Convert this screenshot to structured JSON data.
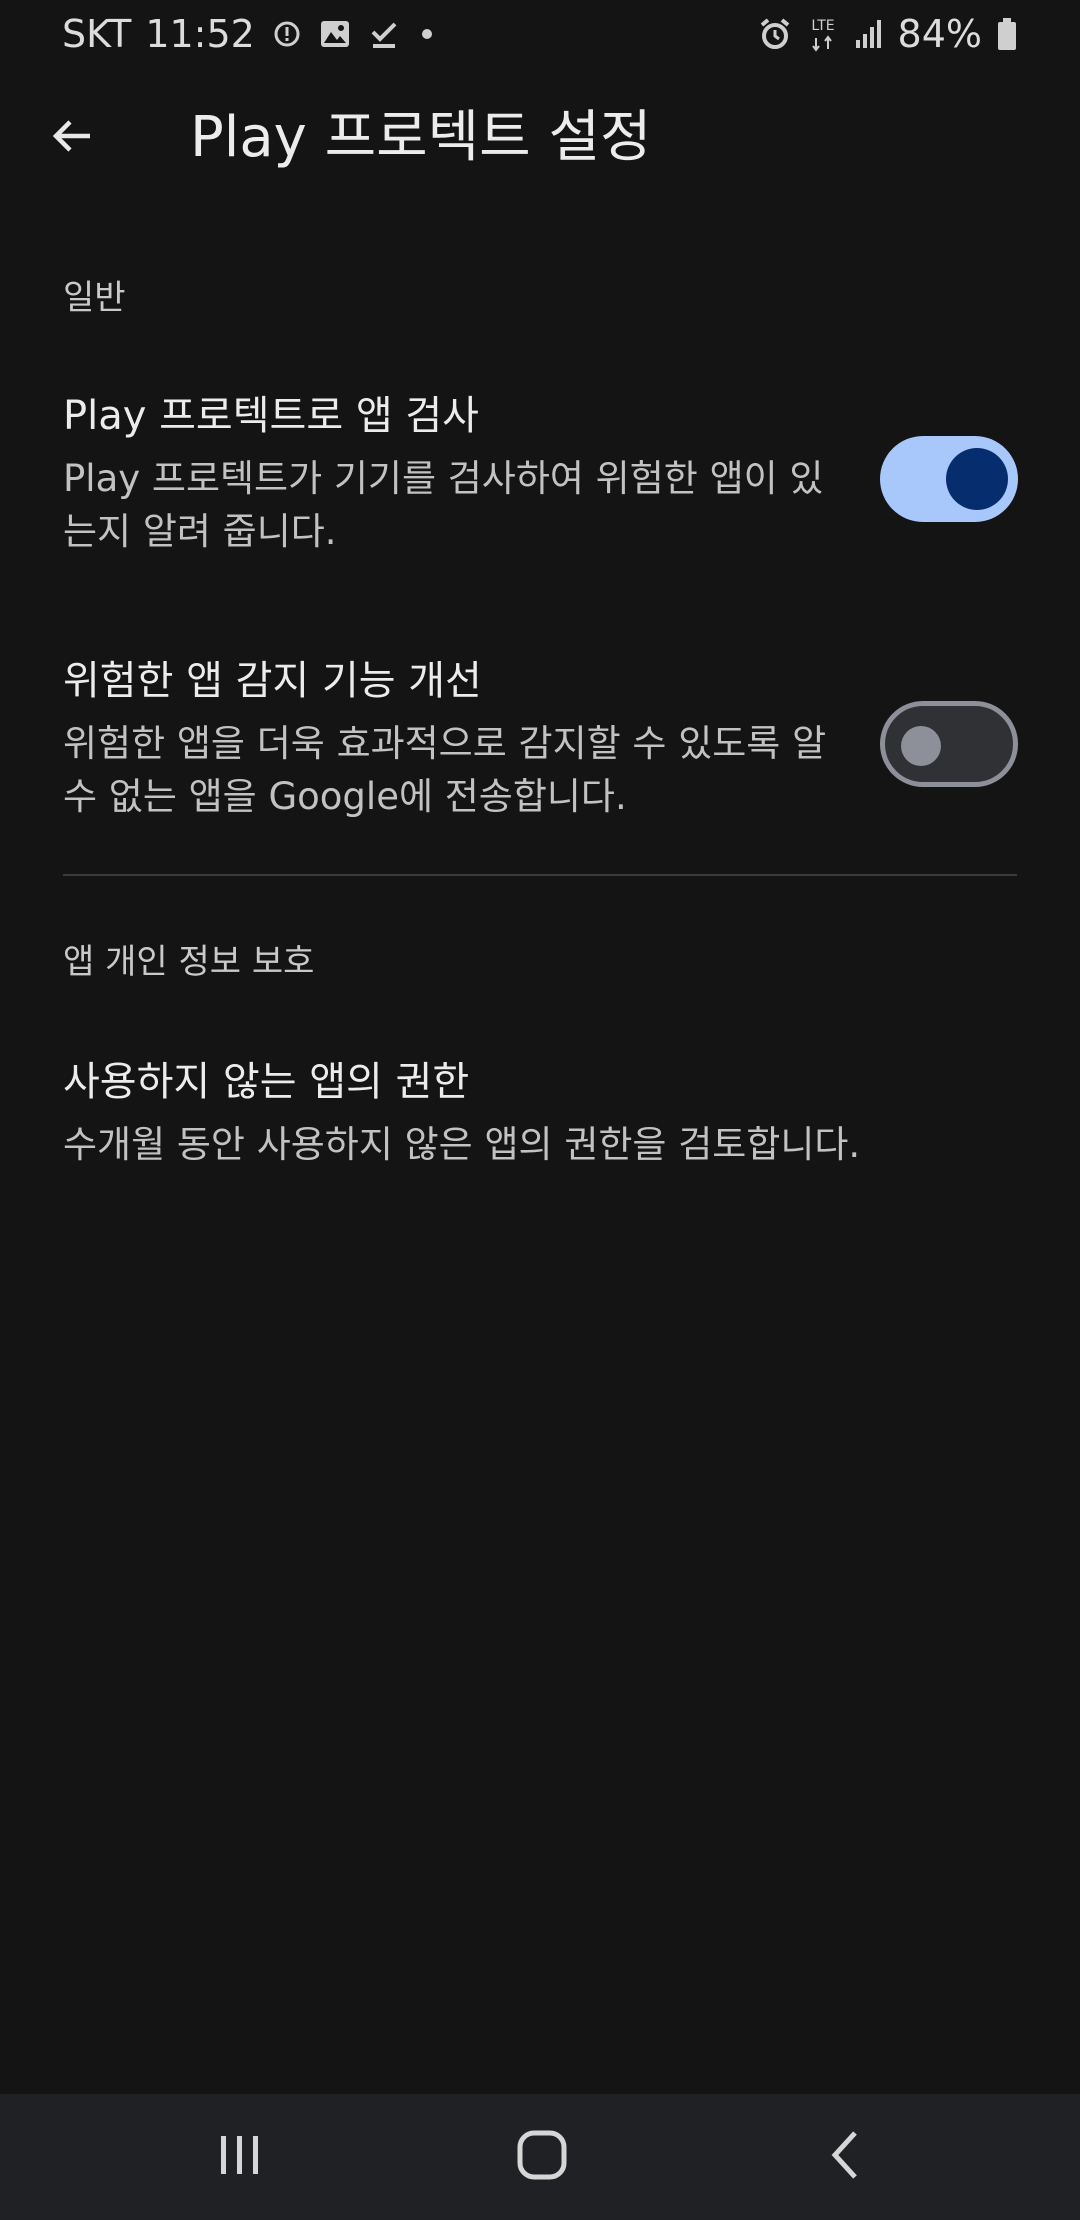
{
  "status_bar": {
    "carrier": "SKT",
    "time": "11:52",
    "network_label": "LTE",
    "battery_text": "84%",
    "icons_left": [
      "info-icon",
      "image-icon",
      "download-done-icon",
      "dot-icon"
    ],
    "icons_right": [
      "alarm-icon",
      "lte-icon",
      "signal-icon",
      "battery-icon"
    ]
  },
  "app_bar": {
    "title": "Play 프로텍트 설정",
    "back_icon": "arrow-back-icon"
  },
  "sections": [
    {
      "header": "일반",
      "items": [
        {
          "title": "Play 프로텍트로 앱 검사",
          "summary": "Play 프로텍트가 기기를 검사하여 위험한 앱이 있는지 알려 줍니다.",
          "toggle": true
        },
        {
          "title": "위험한 앱 감지 기능 개선",
          "summary": "위험한 앱을 더욱 효과적으로 감지할 수 있도록 알 수 없는 앱을 Google에 전송합니다.",
          "toggle": false
        }
      ]
    },
    {
      "header": "앱 개인 정보 보호",
      "items": [
        {
          "title": "사용하지 않는 앱의 권한",
          "summary": "수개월 동안 사용하지 않은 앱의 권한을 검토합니다."
        }
      ]
    }
  ],
  "nav_bar": {
    "recents_icon": "recents-icon",
    "home_icon": "home-icon",
    "back_icon": "nav-back-icon"
  },
  "colors": {
    "background": "#141415",
    "toggle_on_track": "#a8c7fa",
    "toggle_on_thumb": "#062e6f",
    "toggle_off_outline": "#8e9099",
    "nav_bar": "#202124"
  }
}
